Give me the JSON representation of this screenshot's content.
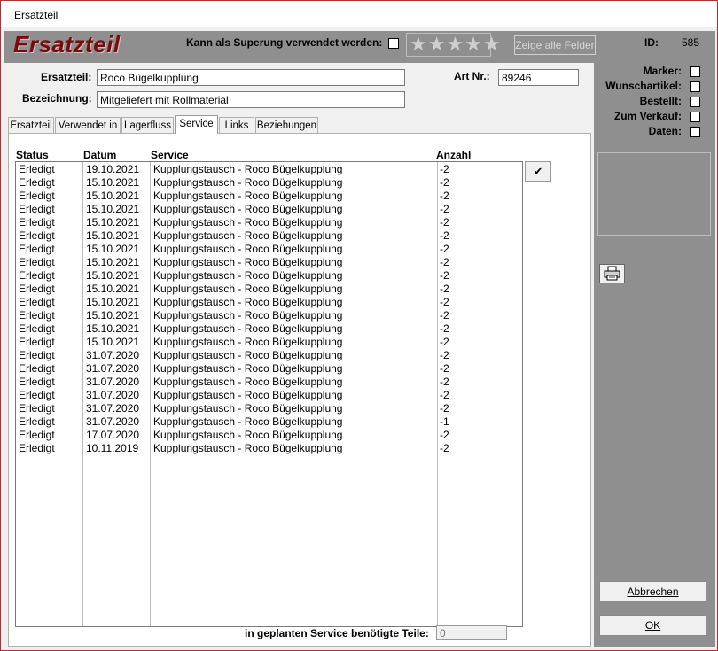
{
  "window": {
    "title": "Ersatzteil"
  },
  "header": {
    "logo": "Ersatzteil",
    "superung_label": "Kann als Superung verwendet werden:",
    "stars": "★★★★★",
    "show_all_label": "Zeige alle Felder",
    "id_label": "ID:",
    "id_value": "585"
  },
  "form": {
    "ersatzteil_label": "Ersatzteil:",
    "ersatzteil_value": "Roco Bügelkupplung",
    "bezeichnung_label": "Bezeichnung:",
    "bezeichnung_value": "Mitgeliefert mit Rollmaterial",
    "artnr_label": "Art Nr.:",
    "artnr_value": "89246"
  },
  "flags": [
    {
      "label": "Marker:"
    },
    {
      "label": "Wunschartikel:"
    },
    {
      "label": "Bestellt:"
    },
    {
      "label": "Zum Verkauf:"
    },
    {
      "label": "Daten:"
    }
  ],
  "tabs": [
    {
      "label": "Ersatzteil"
    },
    {
      "label": "Verwendet in"
    },
    {
      "label": "Lagerfluss"
    },
    {
      "label": "Service"
    },
    {
      "label": "Links"
    },
    {
      "label": "Beziehungen"
    }
  ],
  "active_tab": "Service",
  "table": {
    "columns": [
      "Status",
      "Datum",
      "Service",
      "Anzahl"
    ],
    "rows": [
      [
        "Erledigt",
        "19.10.2021",
        "Kupplungstausch - Roco Bügelkupplung",
        "-2"
      ],
      [
        "Erledigt",
        "15.10.2021",
        "Kupplungstausch - Roco Bügelkupplung",
        "-2"
      ],
      [
        "Erledigt",
        "15.10.2021",
        "Kupplungstausch - Roco Bügelkupplung",
        "-2"
      ],
      [
        "Erledigt",
        "15.10.2021",
        "Kupplungstausch - Roco Bügelkupplung",
        "-2"
      ],
      [
        "Erledigt",
        "15.10.2021",
        "Kupplungstausch - Roco Bügelkupplung",
        "-2"
      ],
      [
        "Erledigt",
        "15.10.2021",
        "Kupplungstausch - Roco Bügelkupplung",
        "-2"
      ],
      [
        "Erledigt",
        "15.10.2021",
        "Kupplungstausch - Roco Bügelkupplung",
        "-2"
      ],
      [
        "Erledigt",
        "15.10.2021",
        "Kupplungstausch - Roco Bügelkupplung",
        "-2"
      ],
      [
        "Erledigt",
        "15.10.2021",
        "Kupplungstausch - Roco Bügelkupplung",
        "-2"
      ],
      [
        "Erledigt",
        "15.10.2021",
        "Kupplungstausch - Roco Bügelkupplung",
        "-2"
      ],
      [
        "Erledigt",
        "15.10.2021",
        "Kupplungstausch - Roco Bügelkupplung",
        "-2"
      ],
      [
        "Erledigt",
        "15.10.2021",
        "Kupplungstausch - Roco Bügelkupplung",
        "-2"
      ],
      [
        "Erledigt",
        "15.10.2021",
        "Kupplungstausch - Roco Bügelkupplung",
        "-2"
      ],
      [
        "Erledigt",
        "15.10.2021",
        "Kupplungstausch - Roco Bügelkupplung",
        "-2"
      ],
      [
        "Erledigt",
        "31.07.2020",
        "Kupplungstausch - Roco Bügelkupplung",
        "-2"
      ],
      [
        "Erledigt",
        "31.07.2020",
        "Kupplungstausch - Roco Bügelkupplung",
        "-2"
      ],
      [
        "Erledigt",
        "31.07.2020",
        "Kupplungstausch - Roco Bügelkupplung",
        "-2"
      ],
      [
        "Erledigt",
        "31.07.2020",
        "Kupplungstausch - Roco Bügelkupplung",
        "-2"
      ],
      [
        "Erledigt",
        "31.07.2020",
        "Kupplungstausch - Roco Bügelkupplung",
        "-2"
      ],
      [
        "Erledigt",
        "31.07.2020",
        "Kupplungstausch - Roco Bügelkupplung",
        "-1"
      ],
      [
        "Erledigt",
        "17.07.2020",
        "Kupplungstausch - Roco Bügelkupplung",
        "-2"
      ],
      [
        "Erledigt",
        "10.11.2019",
        "Kupplungstausch - Roco Bügelkupplung",
        "-2"
      ]
    ]
  },
  "footer": {
    "label": "in geplanten Service benötigte Teile:",
    "value": "0"
  },
  "buttons": {
    "confirm_icon": "✔",
    "print_icon": "printer-icon",
    "cancel_label": "Abbrechen",
    "ok_label": "OK"
  },
  "colors": {
    "panel_gray": "#8f8f8f",
    "logo_red": "#7a0b0b",
    "window_border": "#b03030"
  }
}
